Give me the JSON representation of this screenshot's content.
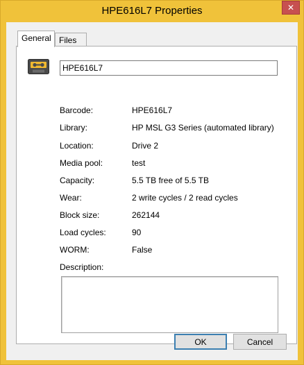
{
  "window": {
    "title": "HPE616L7 Properties",
    "close_symbol": "✕"
  },
  "tabs": [
    {
      "label": "General",
      "active": true
    },
    {
      "label": "Files",
      "active": false
    }
  ],
  "general": {
    "icon": "tape-cartridge-icon",
    "name_value": "HPE616L7",
    "properties": [
      {
        "label": "Barcode:",
        "value": "HPE616L7"
      },
      {
        "label": "Library:",
        "value": "HP MSL G3 Series (automated library)"
      },
      {
        "label": "Location:",
        "value": "Drive 2"
      },
      {
        "label": "Media pool:",
        "value": "test"
      },
      {
        "label": "Capacity:",
        "value": "5.5 TB free of 5.5 TB"
      },
      {
        "label": "Wear:",
        "value": "2 write cycles / 2 read cycles"
      },
      {
        "label": "Block size:",
        "value": "262144"
      },
      {
        "label": "Load cycles:",
        "value": "90"
      },
      {
        "label": "WORM:",
        "value": "False"
      }
    ],
    "description_label": "Description:",
    "description_value": ""
  },
  "buttons": {
    "ok": "OK",
    "cancel": "Cancel"
  },
  "colors": {
    "title_bar": "#f0c23a",
    "close_button": "#c75050",
    "dialog_background": "#f0f0f0"
  }
}
